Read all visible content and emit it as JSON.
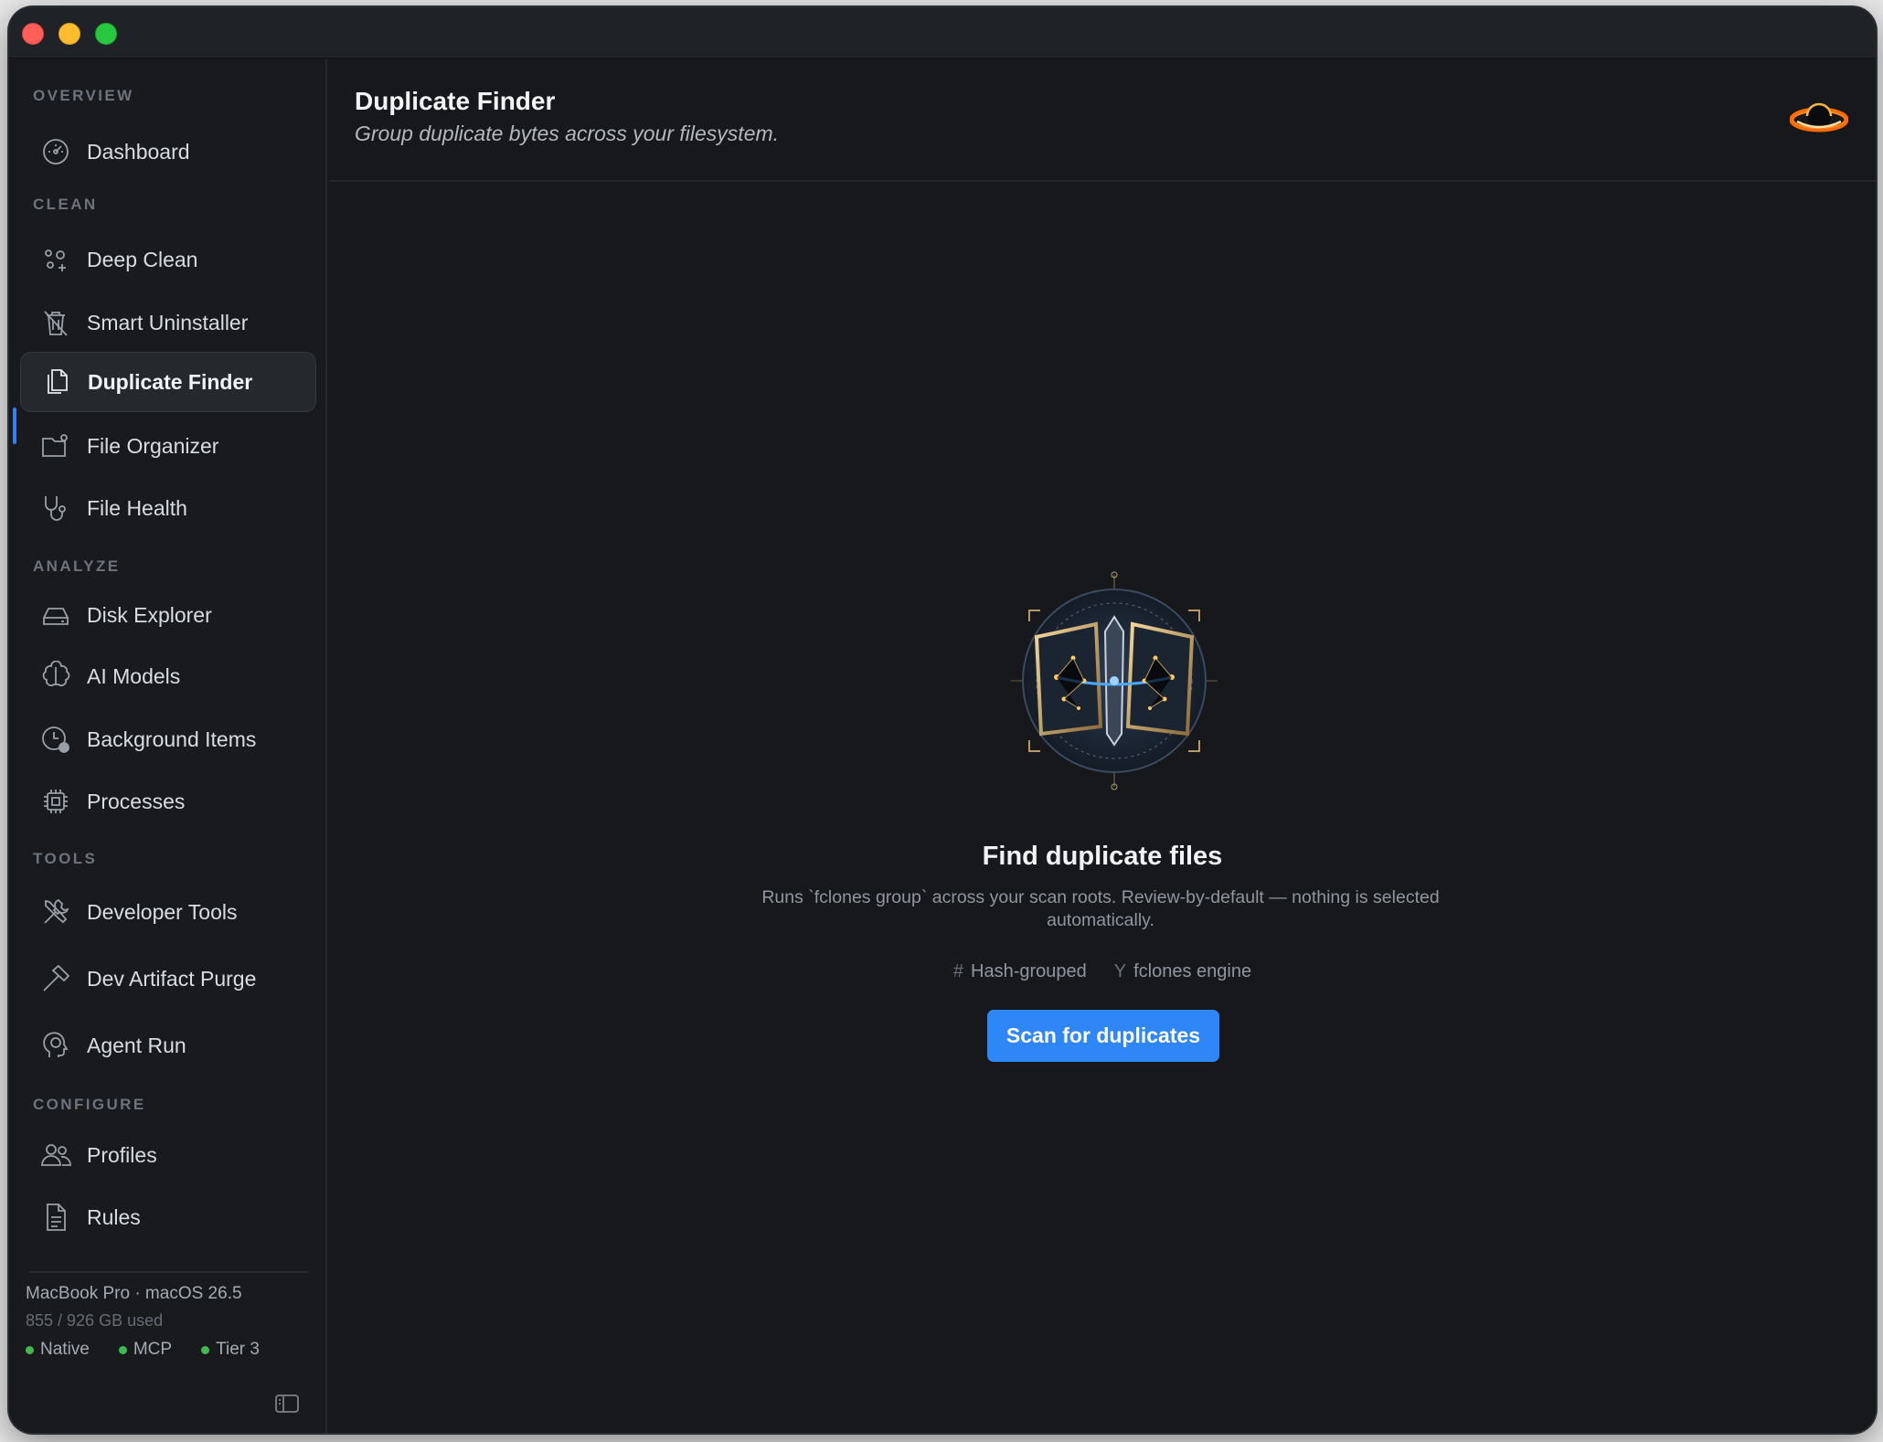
{
  "sidebar": {
    "sections": {
      "overview": "OVERVIEW",
      "clean": "CLEAN",
      "analyze": "ANALYZE",
      "tools": "TOOLS",
      "configure": "CONFIGURE"
    },
    "items": [
      {
        "label": "Dashboard",
        "icon": "gauge-icon"
      },
      {
        "label": "Deep Clean",
        "icon": "sparkles-icon"
      },
      {
        "label": "Smart Uninstaller",
        "icon": "trash-slash-icon"
      },
      {
        "label": "Duplicate Finder",
        "icon": "duplicate-docs-icon",
        "active": true
      },
      {
        "label": "File Organizer",
        "icon": "folder-gear-icon"
      },
      {
        "label": "File Health",
        "icon": "stethoscope-icon"
      },
      {
        "label": "Disk Explorer",
        "icon": "drive-icon"
      },
      {
        "label": "AI Models",
        "icon": "brain-icon"
      },
      {
        "label": "Background Items",
        "icon": "clock-badge-icon"
      },
      {
        "label": "Processes",
        "icon": "cpu-icon"
      },
      {
        "label": "Developer Tools",
        "icon": "wrench-screwdriver-icon"
      },
      {
        "label": "Dev Artifact Purge",
        "icon": "hammer-icon"
      },
      {
        "label": "Agent Run",
        "icon": "head-brain-icon"
      },
      {
        "label": "Profiles",
        "icon": "people-icon"
      },
      {
        "label": "Rules",
        "icon": "document-icon"
      }
    ],
    "footer": {
      "device": "MacBook Pro · macOS 26.5",
      "storage": "855 / 926 GB used",
      "statuses": [
        "Native",
        "MCP",
        "Tier 3"
      ]
    }
  },
  "header": {
    "title": "Duplicate Finder",
    "subtitle": "Group duplicate bytes across your filesystem."
  },
  "empty_state": {
    "title": "Find duplicate files",
    "description": "Runs `fclones group` across your scan roots. Review-by-default — nothing is selected automatically.",
    "chips": [
      {
        "icon": "#",
        "label": "Hash-grouped"
      },
      {
        "icon": "Y",
        "label": "fclones engine"
      }
    ],
    "button": "Scan for duplicates"
  },
  "colors": {
    "accent": "#2f86f6",
    "status_green": "#3fb950",
    "background": "#16181c",
    "sidebar": "#181a1e"
  }
}
